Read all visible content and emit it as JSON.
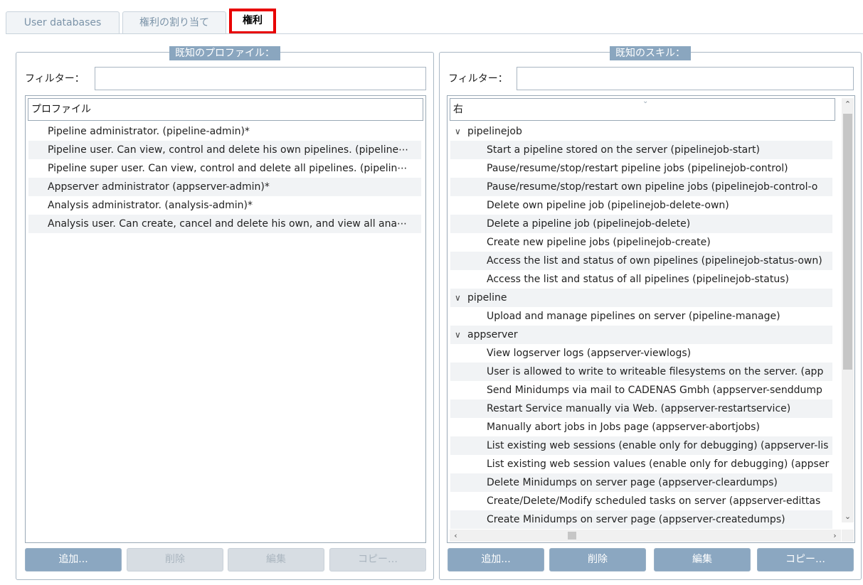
{
  "tabs": [
    {
      "label": "User databases"
    },
    {
      "label": "権利の割り当て"
    },
    {
      "label": "権利"
    }
  ],
  "profiles": {
    "legend": "既知のプロファイル：",
    "filter_label": "フィルター：",
    "filter_value": "",
    "column_header": "プロファイル",
    "rows": [
      "Pipeline administrator. (pipeline-admin)*",
      "Pipeline user. Can view, control and delete his own pipelines. (pipeline⋯",
      "Pipeline super user. Can view, control and delete all pipelines. (pipelin⋯",
      "Appserver administrator (appserver-admin)*",
      "Analysis administrator. (analysis-admin)*",
      "Analysis user. Can create, cancel and delete his own, and view all ana⋯"
    ],
    "buttons": {
      "add": "追加...",
      "delete": "削除",
      "edit": "編集",
      "copy": "コピー…"
    }
  },
  "skills": {
    "legend": "既知のスキル：",
    "filter_label": "フィルター：",
    "filter_value": "",
    "column_header": "右",
    "rows": [
      {
        "type": "cat",
        "text": "pipelinejob"
      },
      {
        "type": "skill",
        "text": "Start a pipeline stored on the server (pipelinejob-start)"
      },
      {
        "type": "skill",
        "text": "Pause/resume/stop/restart pipeline jobs (pipelinejob-control)"
      },
      {
        "type": "skill",
        "text": "Pause/resume/stop/restart own pipeline jobs (pipelinejob-control-o"
      },
      {
        "type": "skill",
        "text": "Delete own pipeline job (pipelinejob-delete-own)"
      },
      {
        "type": "skill",
        "text": "Delete a pipeline job (pipelinejob-delete)"
      },
      {
        "type": "skill",
        "text": "Create new pipeline jobs (pipelinejob-create)"
      },
      {
        "type": "skill",
        "text": "Access the list and status of own pipelines (pipelinejob-status-own)"
      },
      {
        "type": "skill",
        "text": "Access the list and status of all pipelines (pipelinejob-status)"
      },
      {
        "type": "cat",
        "text": "pipeline"
      },
      {
        "type": "skill",
        "text": "Upload and manage pipelines on server (pipeline-manage)"
      },
      {
        "type": "cat",
        "text": "appserver"
      },
      {
        "type": "skill",
        "text": "View logserver logs (appserver-viewlogs)"
      },
      {
        "type": "skill",
        "text": "User is allowed to write to writeable filesystems on the server. (app"
      },
      {
        "type": "skill",
        "text": "Send Minidumps via mail to CADENAS Gmbh (appserver-senddump"
      },
      {
        "type": "skill",
        "text": "Restart Service manually via Web. (appserver-restartservice)"
      },
      {
        "type": "skill",
        "text": "Manually abort jobs in Jobs page (appserver-abortjobs)"
      },
      {
        "type": "skill",
        "text": "List existing web sessions (enable only for debugging) (appserver-lis"
      },
      {
        "type": "skill",
        "text": "List existing web session values (enable only for debugging) (appser"
      },
      {
        "type": "skill",
        "text": "Delete Minidumps on server page (appserver-cleardumps)"
      },
      {
        "type": "skill",
        "text": "Create/Delete/Modify scheduled tasks on server (appserver-edittas"
      },
      {
        "type": "skill",
        "text": "Create Minidumps on server page (appserver-createdumps)"
      }
    ],
    "buttons": {
      "add": "追加...",
      "delete": "削除",
      "edit": "編集",
      "copy": "コピー…"
    }
  }
}
